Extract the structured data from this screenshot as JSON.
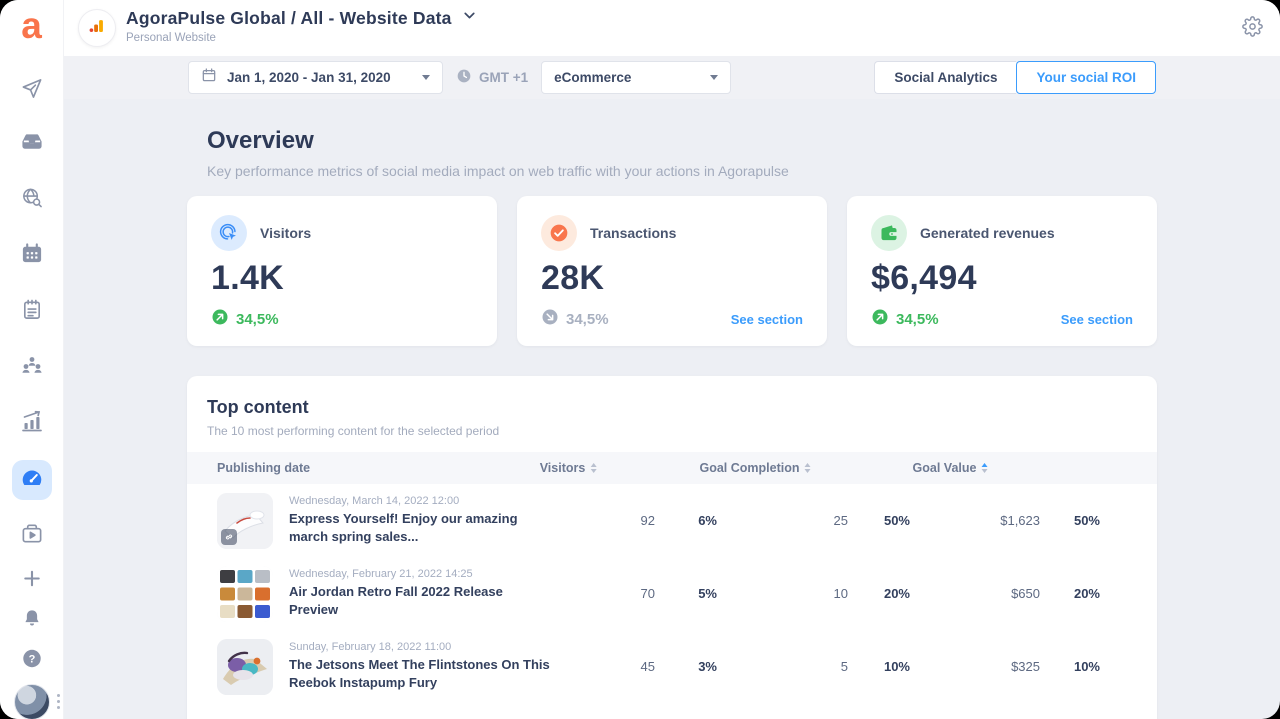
{
  "colors": {
    "accent_blue": "#3b9cfc",
    "green": "#3cb95d",
    "orange": "#f9744b",
    "navy_text": "#2e3a57",
    "gray_text": "#9aa3b8",
    "background": "#edeff4",
    "sidebar_active_bg": "#d8e9fe"
  },
  "sidebar": {
    "logo_letter": "a",
    "items": [
      {
        "name": "publishing",
        "icon": "paper-plane-icon",
        "active": false
      },
      {
        "name": "inbox",
        "icon": "inbox-icon",
        "active": false
      },
      {
        "name": "listening",
        "icon": "globe-search-icon",
        "active": false
      },
      {
        "name": "calendar",
        "icon": "calendar-icon",
        "active": false
      },
      {
        "name": "reports",
        "icon": "notepad-icon",
        "active": false
      },
      {
        "name": "community",
        "icon": "people-icon",
        "active": false
      },
      {
        "name": "statistics",
        "icon": "chart-growth-icon",
        "active": false
      },
      {
        "name": "roi-dashboard",
        "icon": "gauge-icon",
        "active": true
      },
      {
        "name": "media-library",
        "icon": "video-library-icon",
        "active": false
      },
      {
        "name": "add",
        "icon": "plus-icon",
        "active": false
      },
      {
        "name": "notifications",
        "icon": "bell-icon",
        "active": false
      },
      {
        "name": "help",
        "icon": "question-circle-icon",
        "active": false
      }
    ],
    "avatar": "user-avatar",
    "more_menu": "kebab-menu-icon"
  },
  "header": {
    "title": "AgoraPulse Global / All - Website Data",
    "subtitle": "Personal Website",
    "profile_badge_icon": "analytics-bars-icon",
    "title_caret_icon": "chevron-down-icon",
    "settings_icon": "gear-icon"
  },
  "toolbar": {
    "date_range": "Jan 1, 2020 - Jan 31, 2020",
    "timezone": "GMT +1",
    "goal_filter": "eCommerce",
    "tabs": [
      {
        "label": "Social Analytics",
        "active": false
      },
      {
        "label": "Your social ROI",
        "active": true
      }
    ]
  },
  "overview": {
    "title": "Overview",
    "subtitle": "Key performance metrics of social media impact on web traffic with your actions in Agorapulse",
    "cards": [
      {
        "label": "Visitors",
        "value": "1.4K",
        "delta": "34,5%",
        "trend": "up",
        "icon": "cursor-click-icon"
      },
      {
        "label": "Transactions",
        "value": "28K",
        "delta": "34,5%",
        "trend": "down",
        "icon": "check-circle-icon",
        "link": "See section"
      },
      {
        "label": "Generated revenues",
        "value": "$6,494",
        "delta": "34,5%",
        "trend": "up",
        "icon": "wallet-icon",
        "link": "See section"
      }
    ]
  },
  "top_content": {
    "title": "Top content",
    "subtitle": "The 10 most performing content for the selected period",
    "columns": {
      "publishing_date": "Publishing date",
      "visitors": "Visitors",
      "goal_completion": "Goal Completion",
      "goal_value": "Goal Value"
    },
    "sorted_column": "Goal Value",
    "rows": [
      {
        "date": "Wednesday, March 14, 2022 12:00",
        "title": "Express Yourself! Enjoy our amazing march spring sales...",
        "visitors": "92",
        "visitors_pct": "6%",
        "goal_completion": "25",
        "goal_completion_pct": "50%",
        "goal_value": "$1,623",
        "goal_value_pct": "50%"
      },
      {
        "date": "Wednesday, February 21, 2022 14:25",
        "title": "Air Jordan Retro Fall 2022 Release Preview",
        "visitors": "70",
        "visitors_pct": "5%",
        "goal_completion": "10",
        "goal_completion_pct": "20%",
        "goal_value": "$650",
        "goal_value_pct": "20%"
      },
      {
        "date": "Sunday, February 18, 2022 11:00",
        "title": "The Jetsons Meet The Flintstones On This Reebok Instapump Fury",
        "visitors": "45",
        "visitors_pct": "3%",
        "goal_completion": "5",
        "goal_completion_pct": "10%",
        "goal_value": "$325",
        "goal_value_pct": "10%"
      }
    ]
  }
}
